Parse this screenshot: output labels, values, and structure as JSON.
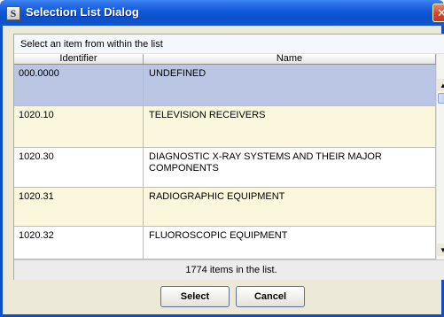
{
  "window": {
    "title": "Selection List Dialog",
    "icon_letter": "S",
    "close_glyph": "✕"
  },
  "instructions": "Select an item from within the list",
  "table": {
    "columns": [
      "Identifier",
      "Name"
    ],
    "rows": [
      {
        "id": "000.0000",
        "name": "UNDEFINED",
        "state": "selected"
      },
      {
        "id": "1020.10",
        "name": "TELEVISION RECEIVERS",
        "state": "alt"
      },
      {
        "id": "1020.30",
        "name": "DIAGNOSTIC X-RAY SYSTEMS AND THEIR MAJOR COMPONENTS",
        "state": "plain"
      },
      {
        "id": "1020.31",
        "name": "RADIOGRAPHIC EQUIPMENT",
        "state": "alt"
      },
      {
        "id": "1020.32",
        "name": "FLUOROSCOPIC EQUIPMENT",
        "state": "plain"
      }
    ]
  },
  "status": "1774 items in the list.",
  "buttons": {
    "select": "Select",
    "cancel": "Cancel"
  },
  "icons": {
    "scroll_up": "▲",
    "scroll_down": "▼"
  },
  "colors": {
    "title_bar": "#0b4fc9",
    "selected_row": "#bac6e4",
    "alt_row": "#fbf7dd",
    "window_bg": "#ece9d8"
  }
}
